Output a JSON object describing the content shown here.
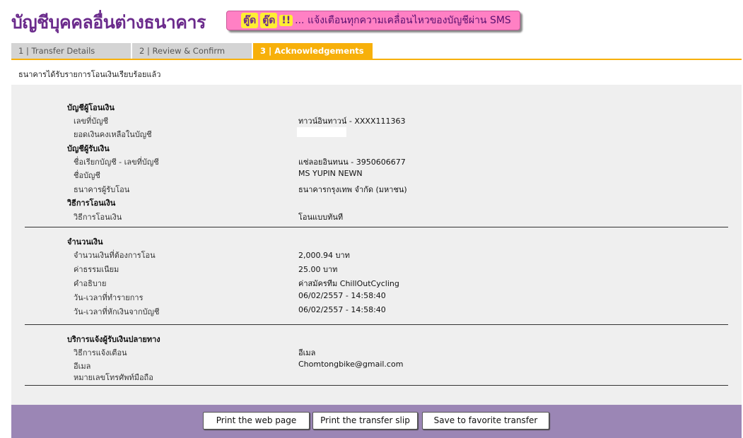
{
  "header": {
    "title": "บัญชีบุคคลอื่นต่างธนาคาร",
    "sms_banner": {
      "tag1": "ตู๊ด",
      "tag2": "ตู๊ด",
      "bang": "!!",
      "text": "... แจ้งเตือนทุกความเคลื่อนไหวของบัญชีผ่าน SMS"
    }
  },
  "tabs": [
    {
      "label": "1 | Transfer Details",
      "active": false
    },
    {
      "label": "2 | Review & Confirm",
      "active": false
    },
    {
      "label": "3 | Acknowledgements",
      "active": true
    }
  ],
  "status_message": "ธนาคารได้รับรายการโอนเงินเรียบร้อยแล้ว",
  "from_account": {
    "section": "บัญชีผู้โอนเงิน",
    "account_number_label": "เลขที่บัญชี",
    "account_number_value": "ทาวน์อินทาวน์ - XXXX111363",
    "balance_label": "ยอดเงินคงเหลือในบัญชี"
  },
  "to_account": {
    "section": "บัญชีผู้รับเงิน",
    "nickname_label": "ชื่อเรียกบัญชี - เลขที่บัญชี",
    "nickname_value": "แซ่ลอยอินทนน - 3950606677",
    "name_label": "ชื่อบัญชี",
    "name_value": "MS YUPIN NEWN",
    "bank_label": "ธนาคารผู้รับโอน",
    "bank_value": "ธนาคารกรุงเทพ จำกัด (มหาชน)"
  },
  "transfer_method": {
    "section": "วิธีการโอนเงิน",
    "label": "วิธีการโอนเงิน",
    "value": "โอนแบบทันที"
  },
  "amount": {
    "section": "จำนวนเงิน",
    "amount_label": "จำนวนเงินที่ต้องการโอน",
    "amount_value": "2,000.94 บาท",
    "fee_label": "ค่าธรรมเนียม",
    "fee_value": "25.00  บาท",
    "desc_label": "คำอธิบาย",
    "desc_value": "ค่าสมัครทีม ChillOutCycling",
    "txn_date_label": "วัน-เวลาที่ทำรายการ",
    "txn_date_value": "06/02/2557 - 14:58:40",
    "debit_date_label": "วัน-เวลาที่หักเงินจากบัญชี",
    "debit_date_value": "06/02/2557 - 14:58:40"
  },
  "notify": {
    "section": "บริการแจ้งผู้รับเงินปลายทาง",
    "method_label": "วิธีการแจ้งเตือน",
    "method_value": "อีเมล",
    "email_label": "อีเมล",
    "email_value": "Chomtongbike@gmail.com",
    "phone_label": "หมายเลขโทรศัพท์มือถือ"
  },
  "buttons": {
    "print_page": "Print the web page",
    "print_slip": "Print the transfer slip",
    "save_favorite": "Save to favorite transfer"
  },
  "colors": {
    "title": "#6b2b8c",
    "active_tab": "#f7b00a",
    "banner": "#ff80c4",
    "button_bar": "#9b86b5",
    "panel": "#efefef"
  }
}
